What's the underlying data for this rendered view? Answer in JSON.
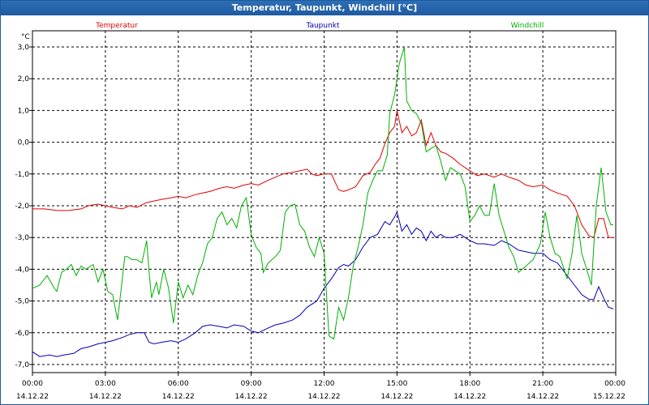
{
  "window": {
    "title": "Temperatur, Taupunkt, Windchill [°C]"
  },
  "chart_data": {
    "type": "line",
    "title": "Temperatur, Taupunkt, Windchill [°C]",
    "ylabel": "°C",
    "xlabel": "",
    "ylim": [
      -7.0,
      3.0
    ],
    "xlim": [
      0,
      24
    ],
    "grid": true,
    "legend_placement": "top",
    "y_ticks": [
      "3,0",
      "2,0",
      "1,0",
      "0,0",
      "-1,0",
      "-2,0",
      "-3,0",
      "-4,0",
      "-5,0",
      "-6,0",
      "-7,0"
    ],
    "x_ticks": [
      {
        "time": "00:00",
        "date": "14.12.22"
      },
      {
        "time": "03:00",
        "date": "14.12.22"
      },
      {
        "time": "06:00",
        "date": "14.12.22"
      },
      {
        "time": "09:00",
        "date": "14.12.22"
      },
      {
        "time": "12:00",
        "date": "14.12.22"
      },
      {
        "time": "15:00",
        "date": "14.12.22"
      },
      {
        "time": "18:00",
        "date": "14.12.22"
      },
      {
        "time": "21:00",
        "date": "14.12.22"
      },
      {
        "time": "00:00",
        "date": "15.12.22"
      }
    ],
    "series": [
      {
        "name": "Temperatur",
        "color": "#e00000",
        "points": [
          [
            0,
            -2.1
          ],
          [
            0.5,
            -2.1
          ],
          [
            1,
            -2.15
          ],
          [
            1.5,
            -2.15
          ],
          [
            2,
            -2.1
          ],
          [
            2.3,
            -2.0
          ],
          [
            2.7,
            -1.95
          ],
          [
            3,
            -2.0
          ],
          [
            3.3,
            -2.05
          ],
          [
            3.7,
            -2.1
          ],
          [
            4,
            -2.0
          ],
          [
            4.3,
            -2.05
          ],
          [
            4.7,
            -1.9
          ],
          [
            5,
            -1.85
          ],
          [
            5.3,
            -1.8
          ],
          [
            5.7,
            -1.75
          ],
          [
            6,
            -1.7
          ],
          [
            6.3,
            -1.75
          ],
          [
            6.7,
            -1.65
          ],
          [
            7,
            -1.6
          ],
          [
            7.3,
            -1.55
          ],
          [
            7.7,
            -1.45
          ],
          [
            8,
            -1.4
          ],
          [
            8.3,
            -1.45
          ],
          [
            8.7,
            -1.35
          ],
          [
            9,
            -1.3
          ],
          [
            9.3,
            -1.35
          ],
          [
            9.7,
            -1.2
          ],
          [
            10,
            -1.1
          ],
          [
            10.3,
            -1.0
          ],
          [
            10.7,
            -0.95
          ],
          [
            11,
            -0.9
          ],
          [
            11.3,
            -0.85
          ],
          [
            11.5,
            -1.0
          ],
          [
            11.7,
            -1.05
          ],
          [
            12,
            -1.0
          ],
          [
            12.3,
            -1.0
          ],
          [
            12.6,
            -1.5
          ],
          [
            12.8,
            -1.55
          ],
          [
            13,
            -1.5
          ],
          [
            13.3,
            -1.4
          ],
          [
            13.6,
            -1.05
          ],
          [
            13.9,
            -0.95
          ],
          [
            14.1,
            -0.7
          ],
          [
            14.3,
            -0.5
          ],
          [
            14.5,
            -0.05
          ],
          [
            14.7,
            0.3
          ],
          [
            14.9,
            0.5
          ],
          [
            15.0,
            1.0
          ],
          [
            15.2,
            0.3
          ],
          [
            15.4,
            0.5
          ],
          [
            15.6,
            0.2
          ],
          [
            15.8,
            0.3
          ],
          [
            16.0,
            0.7
          ],
          [
            16.2,
            -0.1
          ],
          [
            16.4,
            0.3
          ],
          [
            16.6,
            -0.1
          ],
          [
            16.8,
            -0.3
          ],
          [
            17.0,
            -0.35
          ],
          [
            17.3,
            -0.5
          ],
          [
            17.6,
            -0.7
          ],
          [
            18.0,
            -0.9
          ],
          [
            18.3,
            -1.05
          ],
          [
            18.6,
            -1.0
          ],
          [
            19.0,
            -1.1
          ],
          [
            19.3,
            -1.0
          ],
          [
            19.6,
            -1.1
          ],
          [
            20.0,
            -1.2
          ],
          [
            20.3,
            -1.35
          ],
          [
            20.6,
            -1.4
          ],
          [
            21.0,
            -1.35
          ],
          [
            21.3,
            -1.5
          ],
          [
            21.6,
            -1.6
          ],
          [
            22.0,
            -1.7
          ],
          [
            22.3,
            -2.0
          ],
          [
            22.6,
            -2.6
          ],
          [
            22.9,
            -2.95
          ],
          [
            23.1,
            -3.0
          ],
          [
            23.3,
            -2.4
          ],
          [
            23.5,
            -2.4
          ],
          [
            23.7,
            -3.0
          ],
          [
            23.9,
            -3.0
          ]
        ]
      },
      {
        "name": "Taupunkt",
        "color": "#0000b0",
        "points": [
          [
            0,
            -6.6
          ],
          [
            0.3,
            -6.75
          ],
          [
            0.7,
            -6.7
          ],
          [
            1,
            -6.75
          ],
          [
            1.3,
            -6.7
          ],
          [
            1.7,
            -6.65
          ],
          [
            2,
            -6.5
          ],
          [
            2.3,
            -6.45
          ],
          [
            2.7,
            -6.35
          ],
          [
            3,
            -6.3
          ],
          [
            3.3,
            -6.25
          ],
          [
            3.7,
            -6.15
          ],
          [
            4,
            -6.05
          ],
          [
            4.3,
            -6.0
          ],
          [
            4.6,
            -6.0
          ],
          [
            4.8,
            -6.3
          ],
          [
            5,
            -6.35
          ],
          [
            5.3,
            -6.3
          ],
          [
            5.7,
            -6.25
          ],
          [
            6,
            -6.3
          ],
          [
            6.3,
            -6.2
          ],
          [
            6.7,
            -6.0
          ],
          [
            7,
            -5.8
          ],
          [
            7.3,
            -5.75
          ],
          [
            7.7,
            -5.8
          ],
          [
            8,
            -5.85
          ],
          [
            8.3,
            -5.75
          ],
          [
            8.7,
            -5.8
          ],
          [
            9,
            -5.95
          ],
          [
            9.3,
            -6.0
          ],
          [
            9.7,
            -5.85
          ],
          [
            10,
            -5.75
          ],
          [
            10.3,
            -5.7
          ],
          [
            10.7,
            -5.6
          ],
          [
            11,
            -5.45
          ],
          [
            11.3,
            -5.2
          ],
          [
            11.7,
            -5.0
          ],
          [
            12,
            -4.6
          ],
          [
            12.3,
            -4.3
          ],
          [
            12.6,
            -3.95
          ],
          [
            12.8,
            -3.85
          ],
          [
            13.0,
            -3.9
          ],
          [
            13.3,
            -3.7
          ],
          [
            13.6,
            -3.3
          ],
          [
            13.9,
            -3.0
          ],
          [
            14.2,
            -2.9
          ],
          [
            14.5,
            -2.5
          ],
          [
            14.7,
            -2.6
          ],
          [
            14.9,
            -2.35
          ],
          [
            15.0,
            -2.2
          ],
          [
            15.2,
            -2.8
          ],
          [
            15.4,
            -2.6
          ],
          [
            15.6,
            -2.9
          ],
          [
            15.8,
            -2.7
          ],
          [
            16.0,
            -2.8
          ],
          [
            16.2,
            -3.1
          ],
          [
            16.4,
            -2.8
          ],
          [
            16.6,
            -3.0
          ],
          [
            16.8,
            -2.9
          ],
          [
            17.0,
            -3.0
          ],
          [
            17.3,
            -3.0
          ],
          [
            17.6,
            -2.9
          ],
          [
            18.0,
            -3.1
          ],
          [
            18.3,
            -3.2
          ],
          [
            18.6,
            -3.2
          ],
          [
            19.0,
            -3.25
          ],
          [
            19.3,
            -3.1
          ],
          [
            19.6,
            -3.2
          ],
          [
            20.0,
            -3.4
          ],
          [
            20.3,
            -3.45
          ],
          [
            20.6,
            -3.5
          ],
          [
            21.0,
            -3.5
          ],
          [
            21.3,
            -3.7
          ],
          [
            21.6,
            -3.8
          ],
          [
            22.0,
            -4.2
          ],
          [
            22.3,
            -4.5
          ],
          [
            22.6,
            -4.8
          ],
          [
            22.9,
            -4.95
          ],
          [
            23.1,
            -4.95
          ],
          [
            23.3,
            -4.55
          ],
          [
            23.5,
            -4.9
          ],
          [
            23.7,
            -5.2
          ],
          [
            23.9,
            -5.25
          ]
        ]
      },
      {
        "name": "Windchill",
        "color": "#00b000",
        "points": [
          [
            0,
            -4.6
          ],
          [
            0.3,
            -4.5
          ],
          [
            0.6,
            -4.2
          ],
          [
            0.9,
            -4.6
          ],
          [
            1.0,
            -4.7
          ],
          [
            1.2,
            -4.1
          ],
          [
            1.4,
            -4.0
          ],
          [
            1.6,
            -3.85
          ],
          [
            1.8,
            -4.2
          ],
          [
            2.0,
            -3.9
          ],
          [
            2.2,
            -4.0
          ],
          [
            2.5,
            -3.85
          ],
          [
            2.7,
            -4.4
          ],
          [
            2.9,
            -4.0
          ],
          [
            3.1,
            -4.7
          ],
          [
            3.3,
            -4.8
          ],
          [
            3.5,
            -5.6
          ],
          [
            3.7,
            -4.3
          ],
          [
            3.8,
            -3.6
          ],
          [
            3.9,
            -3.6
          ],
          [
            4.1,
            -3.7
          ],
          [
            4.3,
            -3.7
          ],
          [
            4.5,
            -3.8
          ],
          [
            4.7,
            -3.1
          ],
          [
            4.8,
            -4.1
          ],
          [
            4.9,
            -4.9
          ],
          [
            5.1,
            -4.4
          ],
          [
            5.2,
            -4.8
          ],
          [
            5.4,
            -4.0
          ],
          [
            5.6,
            -4.6
          ],
          [
            5.8,
            -5.7
          ],
          [
            6.0,
            -4.4
          ],
          [
            6.2,
            -4.9
          ],
          [
            6.4,
            -4.5
          ],
          [
            6.6,
            -4.8
          ],
          [
            6.8,
            -4.2
          ],
          [
            7.0,
            -3.8
          ],
          [
            7.2,
            -3.2
          ],
          [
            7.4,
            -3.0
          ],
          [
            7.6,
            -2.4
          ],
          [
            7.8,
            -2.2
          ],
          [
            8.0,
            -2.6
          ],
          [
            8.2,
            -2.4
          ],
          [
            8.4,
            -2.7
          ],
          [
            8.6,
            -2.0
          ],
          [
            8.8,
            -1.75
          ],
          [
            9.0,
            -2.9
          ],
          [
            9.2,
            -3.3
          ],
          [
            9.4,
            -3.5
          ],
          [
            9.5,
            -4.1
          ],
          [
            9.7,
            -3.8
          ],
          [
            10.0,
            -3.6
          ],
          [
            10.2,
            -3.4
          ],
          [
            10.4,
            -2.2
          ],
          [
            10.6,
            -2.0
          ],
          [
            10.8,
            -1.95
          ],
          [
            11.0,
            -2.6
          ],
          [
            11.2,
            -2.8
          ],
          [
            11.4,
            -3.3
          ],
          [
            11.6,
            -3.6
          ],
          [
            11.8,
            -3.0
          ],
          [
            12.0,
            -3.5
          ],
          [
            12.2,
            -6.1
          ],
          [
            12.4,
            -6.2
          ],
          [
            12.6,
            -5.2
          ],
          [
            12.8,
            -5.6
          ],
          [
            13.0,
            -4.9
          ],
          [
            13.2,
            -3.9
          ],
          [
            13.4,
            -3.3
          ],
          [
            13.6,
            -2.6
          ],
          [
            13.8,
            -1.6
          ],
          [
            14.0,
            -1.2
          ],
          [
            14.2,
            -0.9
          ],
          [
            14.4,
            -0.9
          ],
          [
            14.6,
            -0.4
          ],
          [
            14.7,
            0.9
          ],
          [
            14.9,
            1.5
          ],
          [
            15.1,
            2.5
          ],
          [
            15.3,
            3.0
          ],
          [
            15.4,
            1.3
          ],
          [
            15.6,
            1.0
          ],
          [
            15.8,
            0.9
          ],
          [
            16.0,
            0.6
          ],
          [
            16.2,
            -0.3
          ],
          [
            16.4,
            -0.2
          ],
          [
            16.6,
            -0.1
          ],
          [
            16.8,
            -0.6
          ],
          [
            17.0,
            -1.2
          ],
          [
            17.2,
            -0.8
          ],
          [
            17.4,
            -0.9
          ],
          [
            17.6,
            -1.0
          ],
          [
            17.8,
            -1.4
          ],
          [
            18.0,
            -2.5
          ],
          [
            18.2,
            -2.3
          ],
          [
            18.4,
            -2.0
          ],
          [
            18.6,
            -2.3
          ],
          [
            18.8,
            -2.3
          ],
          [
            19.0,
            -1.3
          ],
          [
            19.2,
            -2.3
          ],
          [
            19.4,
            -2.8
          ],
          [
            19.6,
            -3.3
          ],
          [
            19.8,
            -3.6
          ],
          [
            20.0,
            -4.1
          ],
          [
            20.3,
            -3.9
          ],
          [
            20.6,
            -3.7
          ],
          [
            20.9,
            -3.2
          ],
          [
            21.1,
            -2.2
          ],
          [
            21.3,
            -3.0
          ],
          [
            21.5,
            -3.5
          ],
          [
            21.7,
            -3.6
          ],
          [
            22.0,
            -4.3
          ],
          [
            22.2,
            -3.5
          ],
          [
            22.4,
            -2.3
          ],
          [
            22.6,
            -3.5
          ],
          [
            22.8,
            -4.0
          ],
          [
            23.0,
            -4.5
          ],
          [
            23.2,
            -2.0
          ],
          [
            23.4,
            -0.8
          ],
          [
            23.6,
            -2.2
          ],
          [
            23.8,
            -2.6
          ],
          [
            23.9,
            -2.6
          ]
        ]
      }
    ]
  }
}
